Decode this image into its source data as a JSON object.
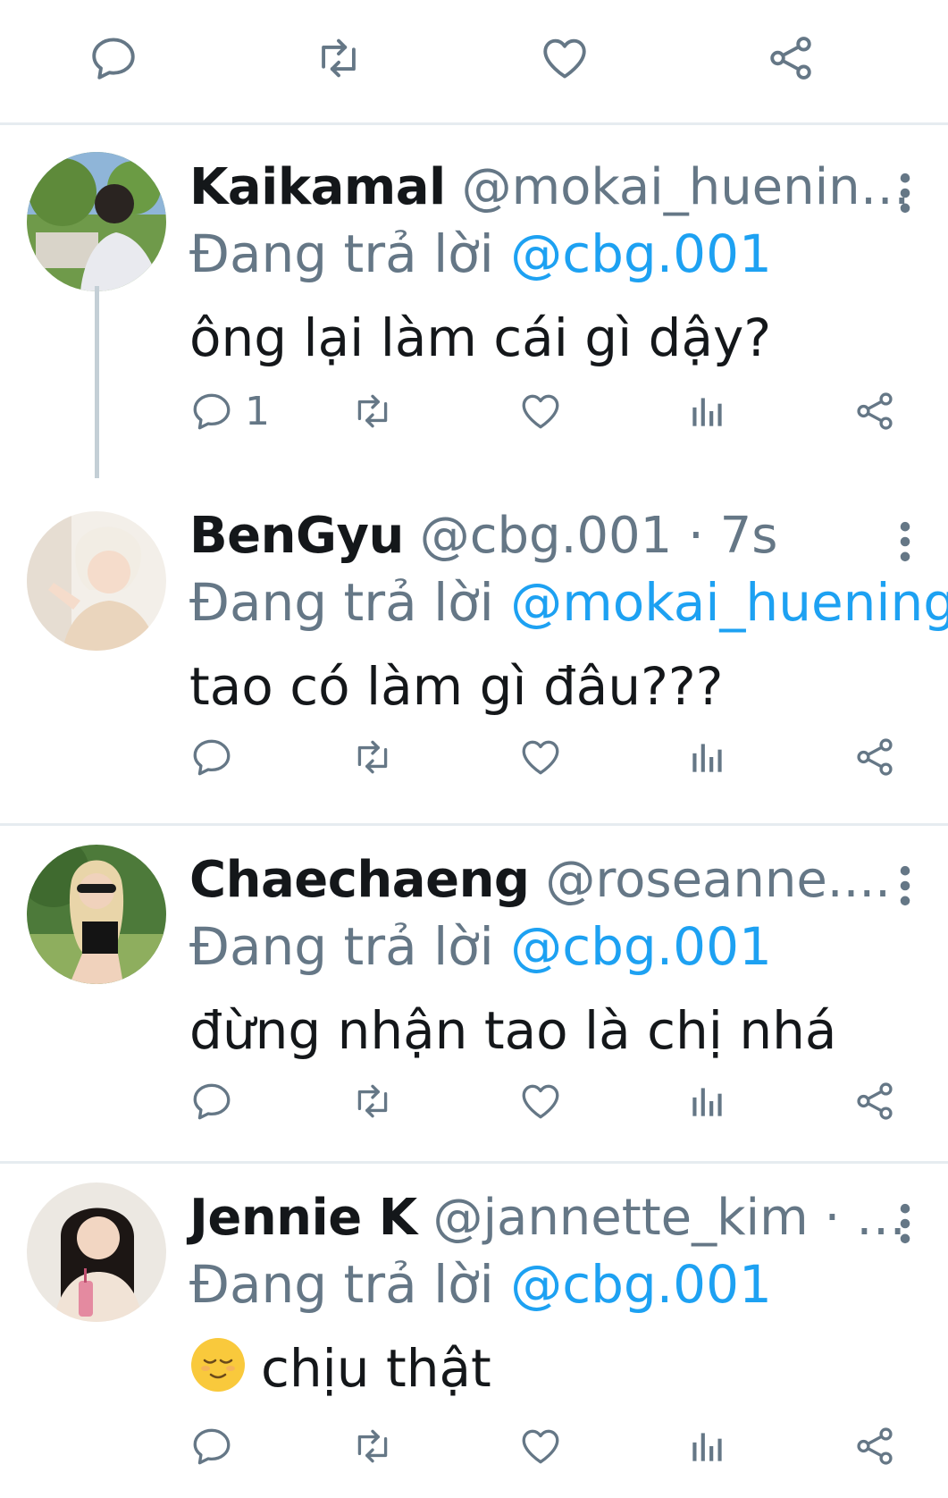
{
  "tweets": [
    {
      "name": "Kaikamal",
      "handle": "@mokai_huenin…",
      "reply_prefix": "Đang trả lời ",
      "reply_to": "@cbg.001",
      "text": "ông lại làm cái gì dậy?",
      "reply_count": "1"
    },
    {
      "name": "BenGyu",
      "handle": "@cbg.001 · 7s",
      "reply_prefix": "Đang trả lời ",
      "reply_to": "@mokai_huening",
      "text": "tao có làm gì đâu???",
      "reply_count": ""
    },
    {
      "name": "Chaechaeng",
      "handle": "@roseanne....",
      "reply_prefix": "Đang trả lời ",
      "reply_to": "@cbg.001",
      "text": "đừng nhận tao là chị nhá",
      "reply_count": ""
    },
    {
      "name": "Jennie K",
      "handle": "@jannette_kim · …",
      "reply_prefix": "Đang trả lời ",
      "reply_to": "@cbg.001",
      "text": "chịu thật",
      "emoji": "relieved-face",
      "reply_count": ""
    }
  ],
  "colors": {
    "accent": "#1da1f2",
    "secondary": "#657786",
    "divider": "#e6ecf0"
  }
}
